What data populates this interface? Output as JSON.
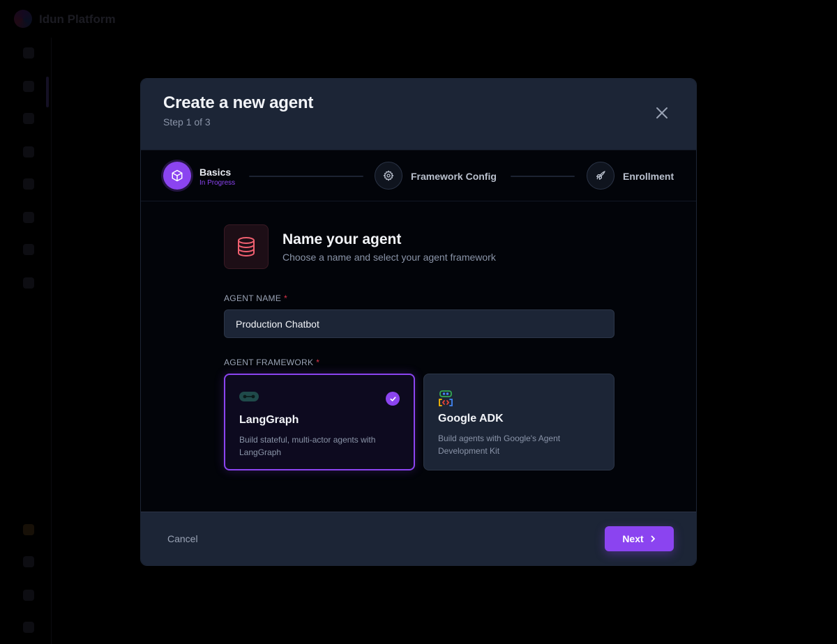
{
  "app": {
    "title": "Idun Platform"
  },
  "modal": {
    "title": "Create a new agent",
    "subtitle": "Step 1 of 3",
    "close_icon": "close-icon"
  },
  "stepper": {
    "steps": [
      {
        "label": "Basics",
        "status": "In Progress",
        "icon": "cube-icon",
        "state": "active"
      },
      {
        "label": "Framework Config",
        "status": "",
        "icon": "gear-icon",
        "state": "pending"
      },
      {
        "label": "Enrollment",
        "status": "",
        "icon": "rocket-icon",
        "state": "pending"
      }
    ]
  },
  "section": {
    "icon": "database-icon",
    "title": "Name your agent",
    "subtitle": "Choose a name and select your agent framework"
  },
  "form": {
    "agent_name_label": "AGENT NAME",
    "agent_name_required": "*",
    "agent_name_value": "Production Chatbot",
    "framework_label": "AGENT FRAMEWORK",
    "framework_required": "*",
    "frameworks": [
      {
        "name": "LangGraph",
        "description": "Build stateful, multi-actor agents with LangGraph",
        "icon": "langgraph-logo-icon",
        "selected": true
      },
      {
        "name": "Google ADK",
        "description": "Build agents with Google's Agent Development Kit",
        "icon": "google-adk-logo-icon",
        "selected": false
      }
    ]
  },
  "footer": {
    "cancel_label": "Cancel",
    "next_label": "Next"
  },
  "colors": {
    "accent": "#8b44f0",
    "panel": "#1c2536",
    "modal_bg": "#020409",
    "required": "#e0344a",
    "hero_icon": "#f06070"
  }
}
